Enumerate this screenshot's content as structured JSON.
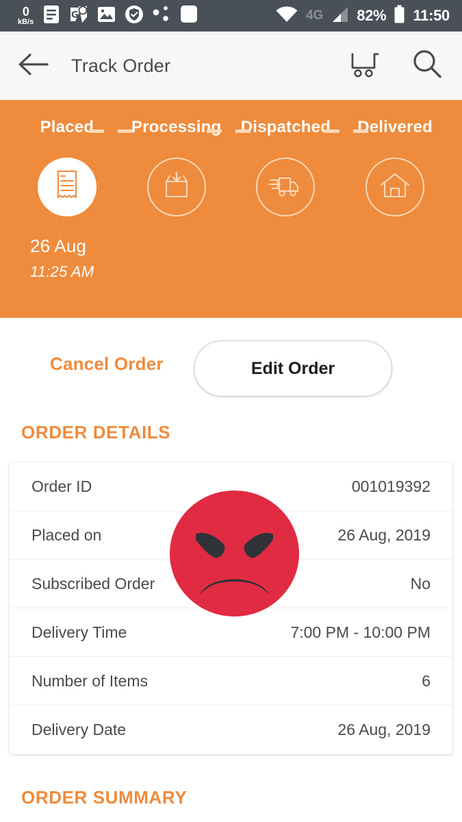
{
  "status_bar": {
    "net_speed_value": "0",
    "net_speed_unit": "kB/s",
    "icons": [
      "document-icon",
      "maps-pin-icon",
      "gallery-icon",
      "shield-check-icon",
      "share-nodes-icon",
      "app-square-icon"
    ],
    "wifi_icon": "wifi-icon",
    "network_type": "4G",
    "signal_icon": "signal-bars-icon",
    "battery_percent": "82%",
    "battery_icon": "battery-icon",
    "clock": "11:50"
  },
  "app_bar": {
    "back_icon": "back-arrow-icon",
    "title": "Track Order",
    "cart_icon": "shopping-cart-icon",
    "search_icon": "search-icon"
  },
  "tracker": {
    "background_color": "#ef8b3c",
    "steps": [
      {
        "label": "Placed",
        "icon": "receipt-icon",
        "state": "active"
      },
      {
        "label": "Processing",
        "icon": "package-box-icon",
        "state": "inactive"
      },
      {
        "label": "Dispatched",
        "icon": "delivery-truck-icon",
        "state": "inactive"
      },
      {
        "label": "Delivered",
        "icon": "home-icon",
        "state": "inactive"
      }
    ],
    "placed_date": "26 Aug",
    "placed_time": "11:25 AM"
  },
  "actions": {
    "cancel_label": "Cancel Order",
    "cancel_color": "#ef8b3c",
    "edit_label": "Edit Order"
  },
  "order_details": {
    "heading": "ORDER DETAILS",
    "rows": [
      {
        "key": "Order ID",
        "value": "001019392"
      },
      {
        "key": "Placed on",
        "value": "26 Aug, 2019"
      },
      {
        "key": "Subscribed Order",
        "value": "No"
      },
      {
        "key": "Delivery Time",
        "value": "7:00 PM - 10:00 PM"
      },
      {
        "key": "Number of Items",
        "value": "6"
      },
      {
        "key": "Delivery Date",
        "value": "26 Aug, 2019"
      }
    ]
  },
  "order_summary": {
    "heading": "ORDER SUMMARY"
  },
  "overlay": {
    "emoji": "angry-face-emoji",
    "emoji_color": "#e12b42"
  }
}
